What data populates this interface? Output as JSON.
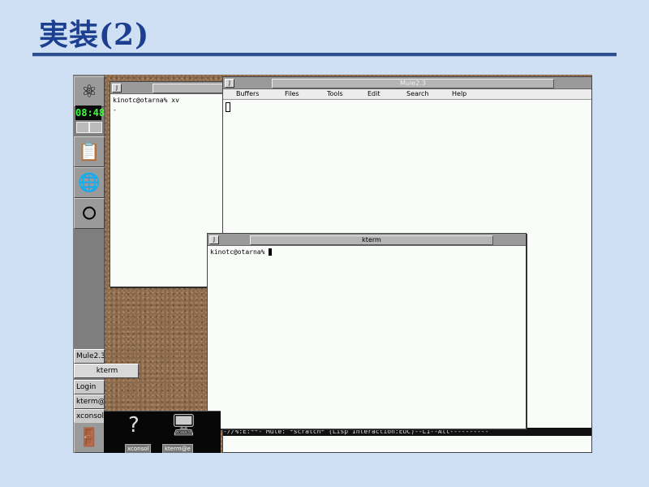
{
  "slide": {
    "title": "実装(2)"
  },
  "dock": {
    "clock": "08:48",
    "tasks": [
      "Mule2.3",
      "kterm",
      "Login",
      "kterm@",
      "xconsol"
    ]
  },
  "windows": {
    "xterm_back": {
      "title": "",
      "prompt": "kinotc@otarna% xv",
      "line2": "-"
    },
    "mule": {
      "title": "Mule2.3",
      "menus": [
        "Buffers",
        "Files",
        "Tools",
        "Edit",
        "Search",
        "Help"
      ],
      "modeline": "-//%:E:**-    Mule: *scratch*       (Lisp Interaction:EUC)--L1--All----------"
    },
    "kterm": {
      "title": "kterm",
      "prompt": "kinotc@otarna% "
    }
  },
  "pager": {
    "labels": [
      "xconsol",
      "kterm@e"
    ]
  }
}
